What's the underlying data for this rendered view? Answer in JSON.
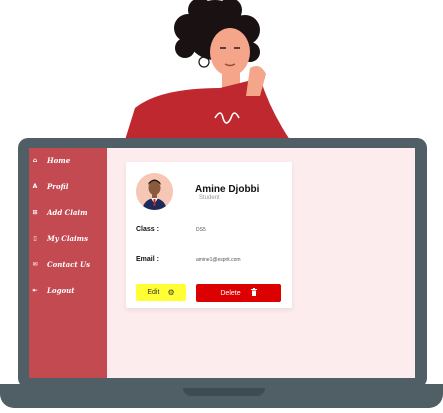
{
  "sidebar": {
    "items": [
      {
        "label": "Home",
        "icon": "home-icon",
        "glyph": "⌂"
      },
      {
        "label": "Profil",
        "icon": "user-icon",
        "glyph": "A"
      },
      {
        "label": "Add Claim",
        "icon": "add-document-icon",
        "glyph": "⊞"
      },
      {
        "label": "My Claims",
        "icon": "document-icon",
        "glyph": "▯"
      },
      {
        "label": "Contact Us",
        "icon": "mail-icon",
        "glyph": "✉"
      },
      {
        "label": "Logout",
        "icon": "logout-icon",
        "glyph": "⇤"
      }
    ]
  },
  "profile": {
    "name": "Amine Djobbi",
    "role": "Student",
    "class_label": "Class :",
    "class_value": "DS5",
    "email_label": "Email :",
    "email_value": "amine1@esprit.com"
  },
  "actions": {
    "edit_label": "Edit",
    "edit_icon": "gear-icon",
    "delete_label": "Delete",
    "delete_icon": "trash-icon"
  },
  "colors": {
    "sidebar": "#c44a52",
    "screen_bg": "#fdecee",
    "laptop": "#505e66",
    "edit": "#ffff33",
    "delete": "#dd0000"
  }
}
